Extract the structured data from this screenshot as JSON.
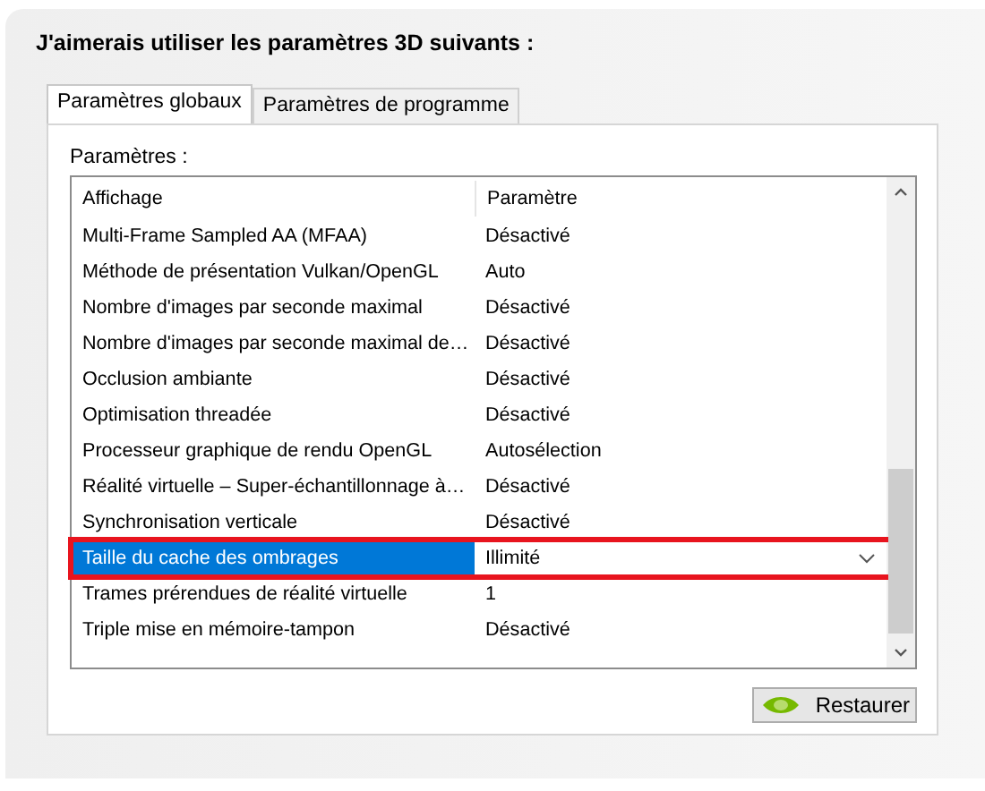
{
  "heading": "J'aimerais utiliser les paramètres 3D suivants :",
  "tabs": [
    {
      "label": "Paramètres globaux",
      "selected": true
    },
    {
      "label": "Paramètres de programme",
      "selected": false
    }
  ],
  "list_label": "Paramètres :",
  "table": {
    "columns": [
      "Affichage",
      "Paramètre"
    ],
    "rows": [
      {
        "name": "Multi-Frame Sampled AA (MFAA)",
        "value": "Désactivé",
        "selected": false
      },
      {
        "name": "Méthode de présentation Vulkan/OpenGL",
        "value": "Auto",
        "selected": false
      },
      {
        "name": "Nombre d'images par seconde maximal",
        "value": "Désactivé",
        "selected": false
      },
      {
        "name": "Nombre d'images par seconde maximal de…",
        "value": "Désactivé",
        "selected": false
      },
      {
        "name": "Occlusion ambiante",
        "value": "Désactivé",
        "selected": false
      },
      {
        "name": "Optimisation threadée",
        "value": "Désactivé",
        "selected": false
      },
      {
        "name": "Processeur graphique de rendu OpenGL",
        "value": "Autosélection",
        "selected": false
      },
      {
        "name": "Réalité virtuelle – Super-échantillonnage à…",
        "value": "Désactivé",
        "selected": false
      },
      {
        "name": "Synchronisation verticale",
        "value": "Désactivé",
        "selected": false
      },
      {
        "name": "Taille du cache des ombrages",
        "value": "Illimité",
        "selected": true
      },
      {
        "name": "Trames prérendues de réalité virtuelle",
        "value": "1",
        "selected": false
      },
      {
        "name": "Triple mise en mémoire-tampon",
        "value": "Désactivé",
        "selected": false
      }
    ]
  },
  "restore_button": "Restaurer"
}
